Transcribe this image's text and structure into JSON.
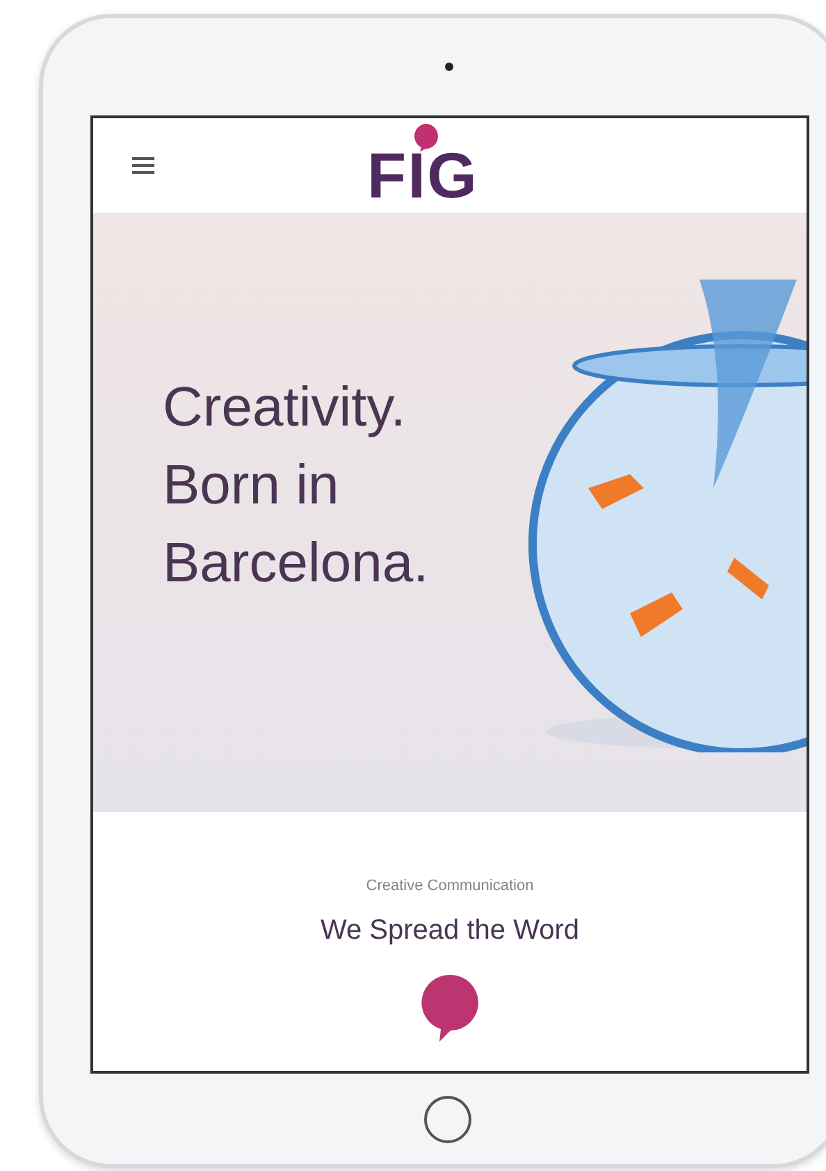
{
  "header": {
    "logo": "FIG"
  },
  "hero": {
    "headline": [
      "Creativity.",
      "Born in",
      "Barcelona."
    ]
  },
  "intro": {
    "eyebrow": "Creative Communication",
    "title": "We Spread the Word"
  }
}
